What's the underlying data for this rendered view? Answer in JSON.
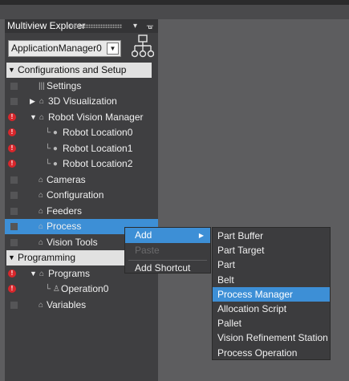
{
  "explorer": {
    "title": "Multiview Explorer",
    "pin_glyph": "▾",
    "dock_glyph": "ᚗ",
    "app_select": {
      "value": "ApplicationManager0"
    },
    "tree": [
      {
        "label": "Configurations and Setup",
        "icon": "",
        "marker": "none",
        "twisty": "▼",
        "header": true
      },
      {
        "label": "Settings",
        "icon": "|||",
        "marker": "sq",
        "twisty": ""
      },
      {
        "label": "3D Visualization",
        "icon": "⌂",
        "marker": "sq",
        "twisty": "▶"
      },
      {
        "label": "Robot Vision Manager",
        "icon": "⌂",
        "marker": "err",
        "twisty": "▼"
      },
      {
        "label": "Robot Location0",
        "icon": "└ ●",
        "marker": "err",
        "twisty": ""
      },
      {
        "label": "Robot Location1",
        "icon": "└ ●",
        "marker": "err",
        "twisty": ""
      },
      {
        "label": "Robot Location2",
        "icon": "└ ●",
        "marker": "err",
        "twisty": ""
      },
      {
        "label": "Cameras",
        "icon": "⌂",
        "marker": "sq",
        "twisty": ""
      },
      {
        "label": "Configuration",
        "icon": "⌂",
        "marker": "sq",
        "twisty": ""
      },
      {
        "label": "Feeders",
        "icon": "⌂",
        "marker": "sq",
        "twisty": ""
      },
      {
        "label": "Process",
        "icon": "⌂",
        "marker": "sq",
        "twisty": "",
        "selected": true
      },
      {
        "label": "Vision Tools",
        "icon": "⌂",
        "marker": "sq",
        "twisty": ""
      },
      {
        "label": "Programming",
        "icon": "",
        "marker": "none",
        "twisty": "▼",
        "header": true
      },
      {
        "label": "Programs",
        "icon": "⌂",
        "marker": "err",
        "twisty": "▼"
      },
      {
        "label": "Operation0",
        "icon": "└ ♙",
        "marker": "err",
        "twisty": ""
      },
      {
        "label": "Variables",
        "icon": "⌂",
        "marker": "sq",
        "twisty": ""
      }
    ]
  },
  "context_menu": {
    "items": [
      {
        "label": "Add",
        "arrow": "▶",
        "active": true
      },
      {
        "label": "Paste",
        "dim": true
      },
      {
        "label": "Add Shortcut"
      }
    ]
  },
  "submenu": {
    "items": [
      {
        "label": "Part Buffer"
      },
      {
        "label": "Part Target"
      },
      {
        "label": "Part"
      },
      {
        "label": "Belt"
      },
      {
        "label": "Process Manager",
        "active": true
      },
      {
        "label": "Allocation Script"
      },
      {
        "label": "Pallet"
      },
      {
        "label": "Vision Refinement Station"
      },
      {
        "label": "Process Operation"
      }
    ]
  },
  "colors": {
    "panel": "#3f3f41",
    "workspace": "#5d5d5f",
    "selection": "#3d8fd6",
    "error": "#d8262b",
    "header": "#e1e1e1"
  }
}
